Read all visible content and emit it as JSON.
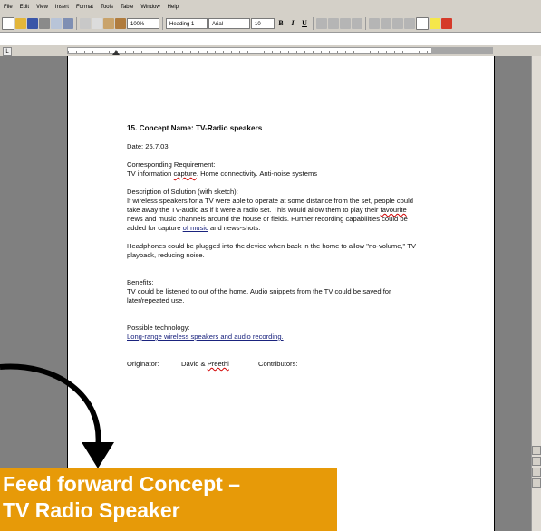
{
  "menubar": {
    "items": [
      "File",
      "Edit",
      "View",
      "Insert",
      "Format",
      "Tools",
      "Table",
      "Window",
      "Help"
    ]
  },
  "toolbar": {
    "zoom": "100%",
    "style": "Heading 1",
    "font": "Arial",
    "size": "10",
    "bold_label": "B",
    "italic_label": "I",
    "underline_label": "U"
  },
  "ruler": {
    "corner": "L"
  },
  "document": {
    "title": "15.  Concept Name: TV-Radio speakers",
    "date": "Date: 25.7.03",
    "req_heading": "Corresponding Requirement:",
    "req_text_a": "TV information ",
    "req_text_capture": "capture",
    "req_text_b": ". Home connectivity. Anti-noise systems",
    "desc_heading": "Description of Solution (with sketch):",
    "desc_line1": "If wireless speakers for a TV were able to operate at some distance from the set, people could",
    "desc_line2": "take away the TV-audio as if it were a radio set.  This would allow them to play their ",
    "desc_line2_word": "favourite",
    "desc_line3": "news and music channels around the house or fields. Further recording capabilities could be",
    "desc_line4_a": "added for capture ",
    "desc_line4_link": "of  music",
    "desc_line4_b": " and news-shots.",
    "headphones_line1": "Headphones could be plugged into the device when back in the home to allow \"no-volume,\" TV",
    "headphones_line2": "playback, reducing noise.",
    "benefits_heading": "Benefits:",
    "benefits_line1": "TV could be listened to out of the home. Audio snippets from the TV could be saved for",
    "benefits_line2": "later/repeated use.",
    "tech_heading": "Possible technology:",
    "tech_text": "Long-range wireless speakers and audio recording.",
    "originator_label": "Originator:",
    "originator_a": "David & ",
    "originator_name": "Preethi",
    "contributors_label": "Contributors:"
  },
  "callout": {
    "line1": "Feed forward Concept –",
    "line2": "TV Radio Speaker",
    "color": "#e79a08"
  },
  "icons": [
    "new-document-icon",
    "open-icon",
    "save-icon",
    "print-icon",
    "print-preview-icon",
    "spelling-icon",
    "cut-icon",
    "copy-icon",
    "paste-icon",
    "format-painter-icon",
    "highlight-icon",
    "font-color-icon",
    "curved-arrow-icon"
  ]
}
